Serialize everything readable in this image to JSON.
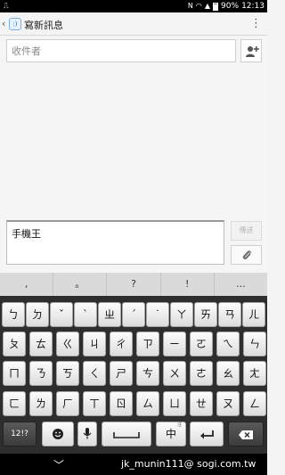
{
  "status_bar": {
    "notification_icon": "usb-icon",
    "battery": "90%",
    "time": "12:13"
  },
  "action_bar": {
    "title": "寫新訊息",
    "icon": "sms-app-icon"
  },
  "recipient": {
    "placeholder": "收件者"
  },
  "compose": {
    "value": "手機王"
  },
  "send_label": "傳送",
  "keyboard": {
    "punctuation": [
      ",",
      "。",
      "?",
      "!",
      "..."
    ],
    "rows": [
      [
        "ㄅ",
        "ㄉ",
        "ˇ",
        "ˋ",
        "ㄓ",
        "ˊ",
        "˙",
        "ㄚ",
        "ㄞ",
        "ㄢ",
        "ㄦ"
      ],
      [
        "ㄆ",
        "ㄊ",
        "ㄍ",
        "ㄐ",
        "ㄔ",
        "ㄗ",
        "ㄧ",
        "ㄛ",
        "ㄟ",
        "ㄣ"
      ],
      [
        "ㄇ",
        "ㄋ",
        "ㄎ",
        "ㄑ",
        "ㄕ",
        "ㄘ",
        "ㄨ",
        "ㄜ",
        "ㄠ",
        "ㄤ"
      ],
      [
        "ㄈ",
        "ㄌ",
        "ㄏ",
        "ㄒ",
        "ㄖ",
        "ㄙ",
        "ㄩ",
        "ㄝ",
        "ㄡ",
        "ㄥ"
      ]
    ],
    "mode_label": "12!?",
    "lang_label": "中",
    "lang_sup": "注"
  },
  "watermark": "jk_munin111@ sogi.com.tw"
}
